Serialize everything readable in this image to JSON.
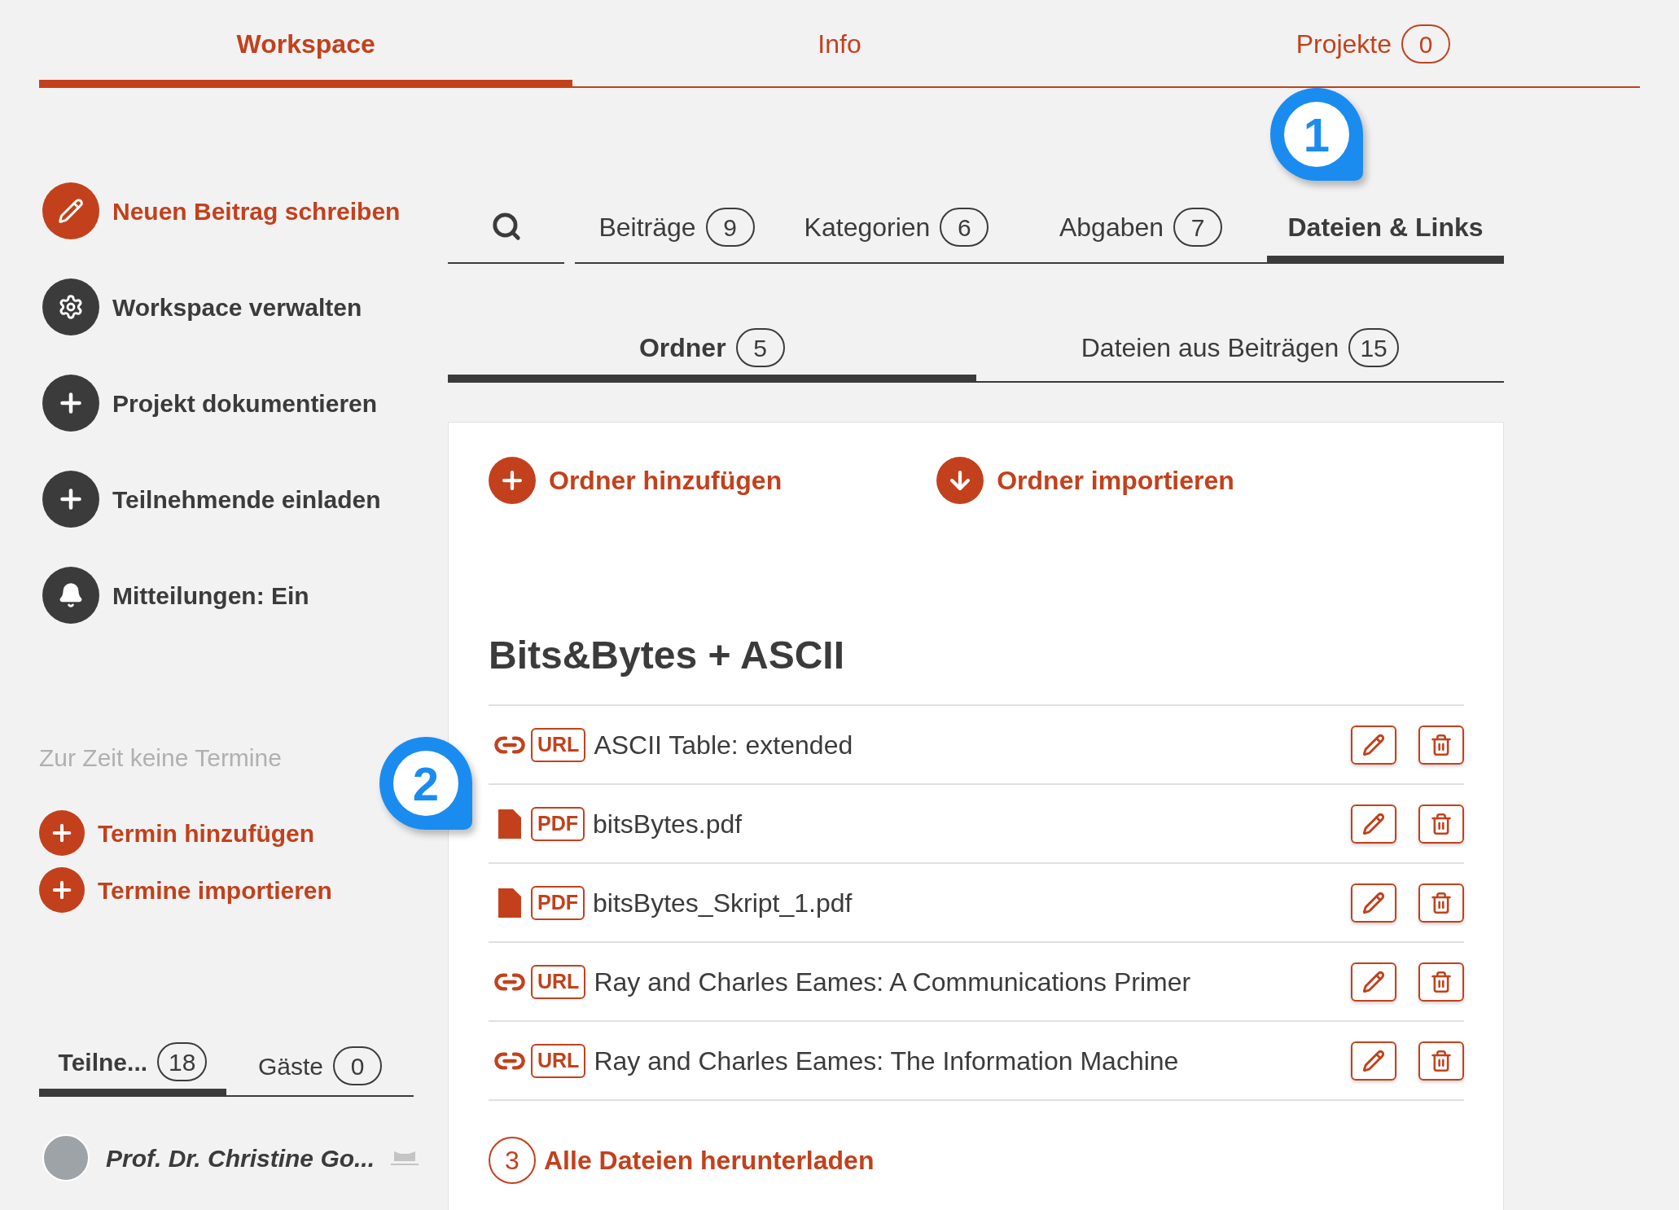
{
  "top_tabs": [
    {
      "label": "Workspace",
      "selected": true
    },
    {
      "label": "Info",
      "selected": false
    },
    {
      "label": "Projekte",
      "count": "0",
      "selected": false
    }
  ],
  "sidebar": {
    "actions": [
      {
        "kind": "pencil",
        "label": "Neuen Beitrag schreiben",
        "highlighted": true
      },
      {
        "kind": "gear",
        "label": "Workspace verwalten",
        "highlighted": false
      },
      {
        "kind": "plus",
        "label": "Projekt dokumentieren",
        "highlighted": false
      },
      {
        "kind": "plus",
        "label": "Teilnehmende einladen",
        "highlighted": false
      },
      {
        "kind": "bell",
        "label": "Mitteilungen: Ein",
        "highlighted": false
      }
    ],
    "events_note": "Zur Zeit keine Termine",
    "event_actions": [
      "Termin hinzufügen",
      "Termine importieren"
    ],
    "member_tabs": [
      {
        "label": "Teilne...",
        "count": "18",
        "selected": true
      },
      {
        "label": "Gäste",
        "count": "0",
        "selected": false
      }
    ],
    "members": [
      {
        "name": "Prof. Dr. Christine Go..."
      }
    ]
  },
  "content_tabs": [
    {
      "label": "Beiträge",
      "count": "9",
      "selected": false
    },
    {
      "label": "Kategorien",
      "count": "6",
      "selected": false
    },
    {
      "label": "Abgaben",
      "count": "7",
      "selected": false
    },
    {
      "label": "Dateien & Links",
      "selected": true
    }
  ],
  "sub_tabs": [
    {
      "label": "Ordner",
      "count": "5",
      "selected": true
    },
    {
      "label": "Dateien aus Beiträgen",
      "count": "15",
      "selected": false
    }
  ],
  "panel": {
    "actions": [
      {
        "kind": "plus",
        "label": "Ordner hinzufügen"
      },
      {
        "kind": "download",
        "label": "Ordner importieren"
      }
    ],
    "folder_title": "Bits&Bytes + ASCII",
    "files": [
      {
        "kind": "url",
        "type_label": "URL",
        "name": "ASCII Table: extended"
      },
      {
        "kind": "pdf",
        "type_label": "PDF",
        "name": "bitsBytes.pdf"
      },
      {
        "kind": "pdf",
        "type_label": "PDF",
        "name": "bitsBytes_Skript_1.pdf"
      },
      {
        "kind": "url",
        "type_label": "URL",
        "name": "Ray and Charles Eames: A Communications Primer"
      },
      {
        "kind": "url",
        "type_label": "URL",
        "name": "Ray and Charles Eames: The Information Machine"
      }
    ],
    "download": {
      "number": "3",
      "label": "Alle Dateien herunterladen"
    }
  },
  "annotations": [
    {
      "number": "1"
    },
    {
      "number": "2"
    }
  ]
}
